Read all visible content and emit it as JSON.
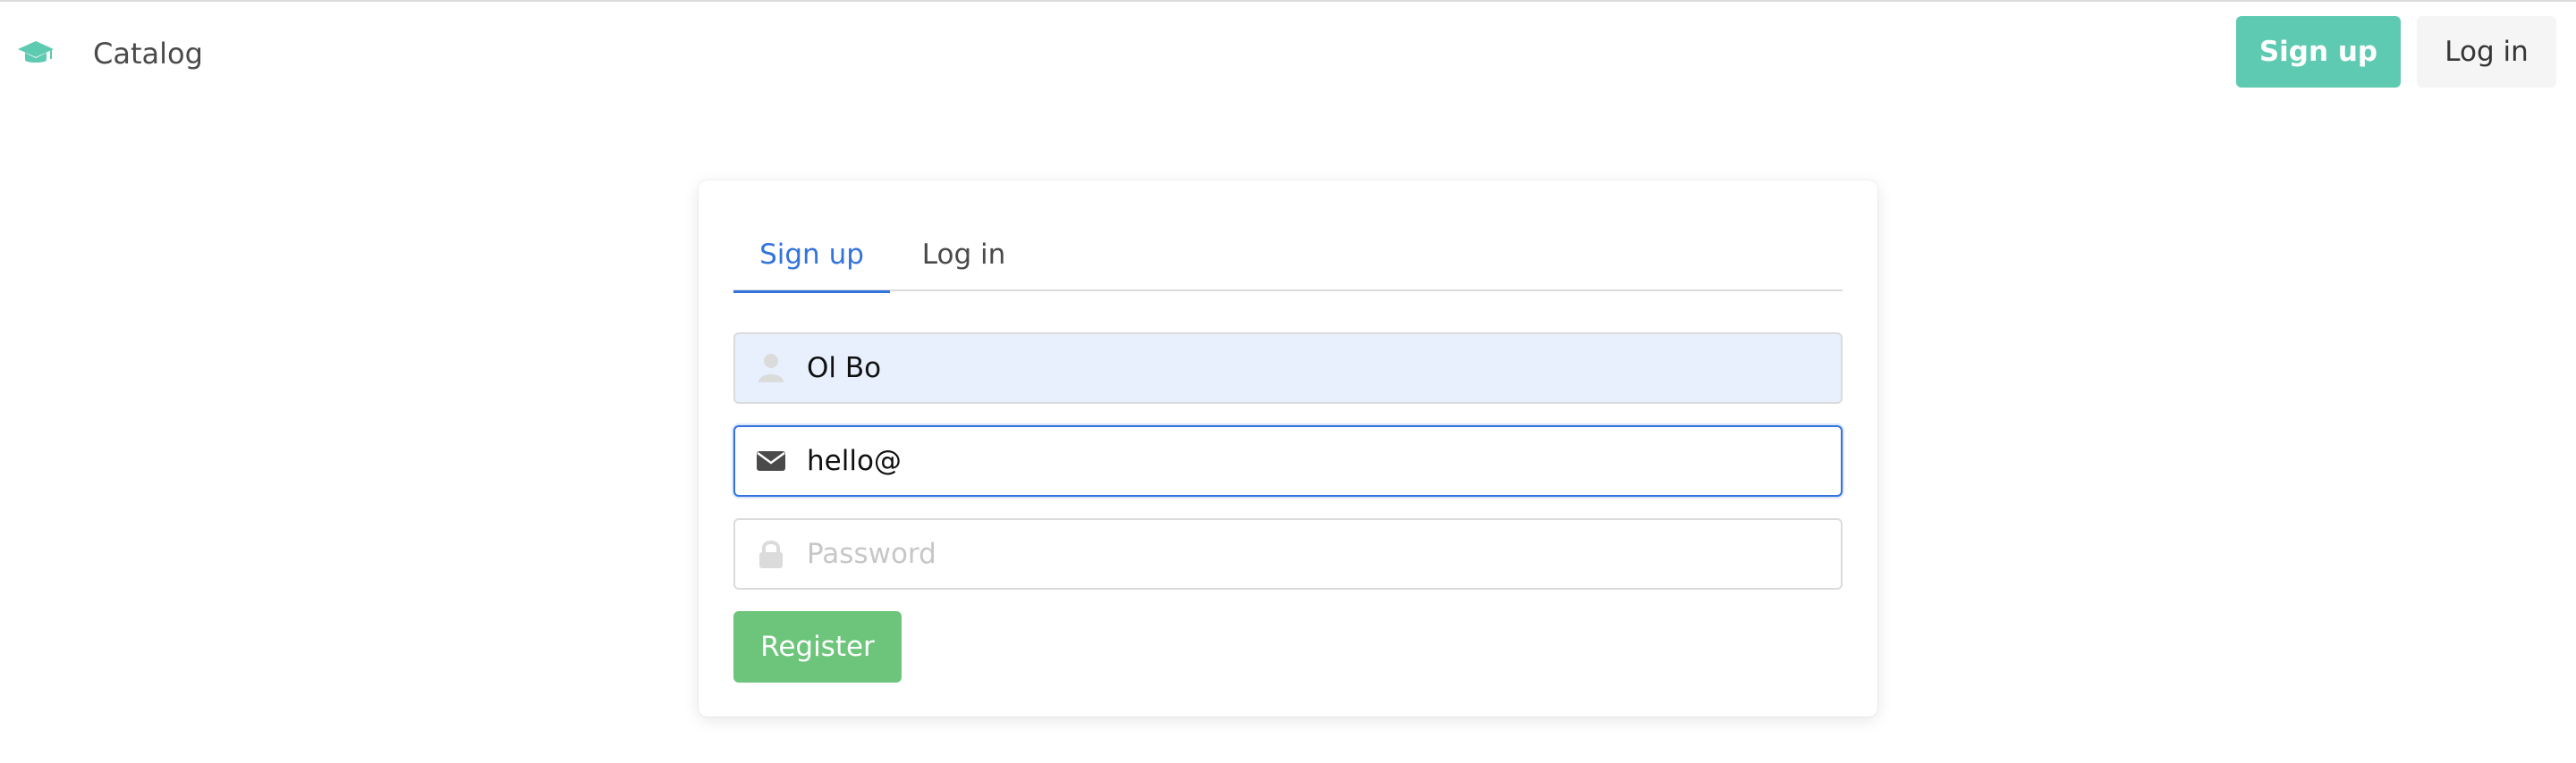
{
  "navbar": {
    "brand_icon": "graduation-cap-icon",
    "brand": "Catalog",
    "signup_label": "Sign up",
    "login_label": "Log in"
  },
  "colors": {
    "accent": "#5ecab1",
    "tab_active": "#3273dc",
    "register": "#6cc57a"
  },
  "auth": {
    "tabs": [
      {
        "label": "Sign up",
        "active": true
      },
      {
        "label": "Log in",
        "active": false
      }
    ],
    "fields": {
      "name": {
        "icon": "user-icon",
        "value": "Ol Bo",
        "placeholder": ""
      },
      "email": {
        "icon": "envelope-icon",
        "value": "hello@",
        "placeholder": ""
      },
      "password": {
        "icon": "lock-icon",
        "value": "",
        "placeholder": "Password"
      }
    },
    "register_label": "Register"
  }
}
